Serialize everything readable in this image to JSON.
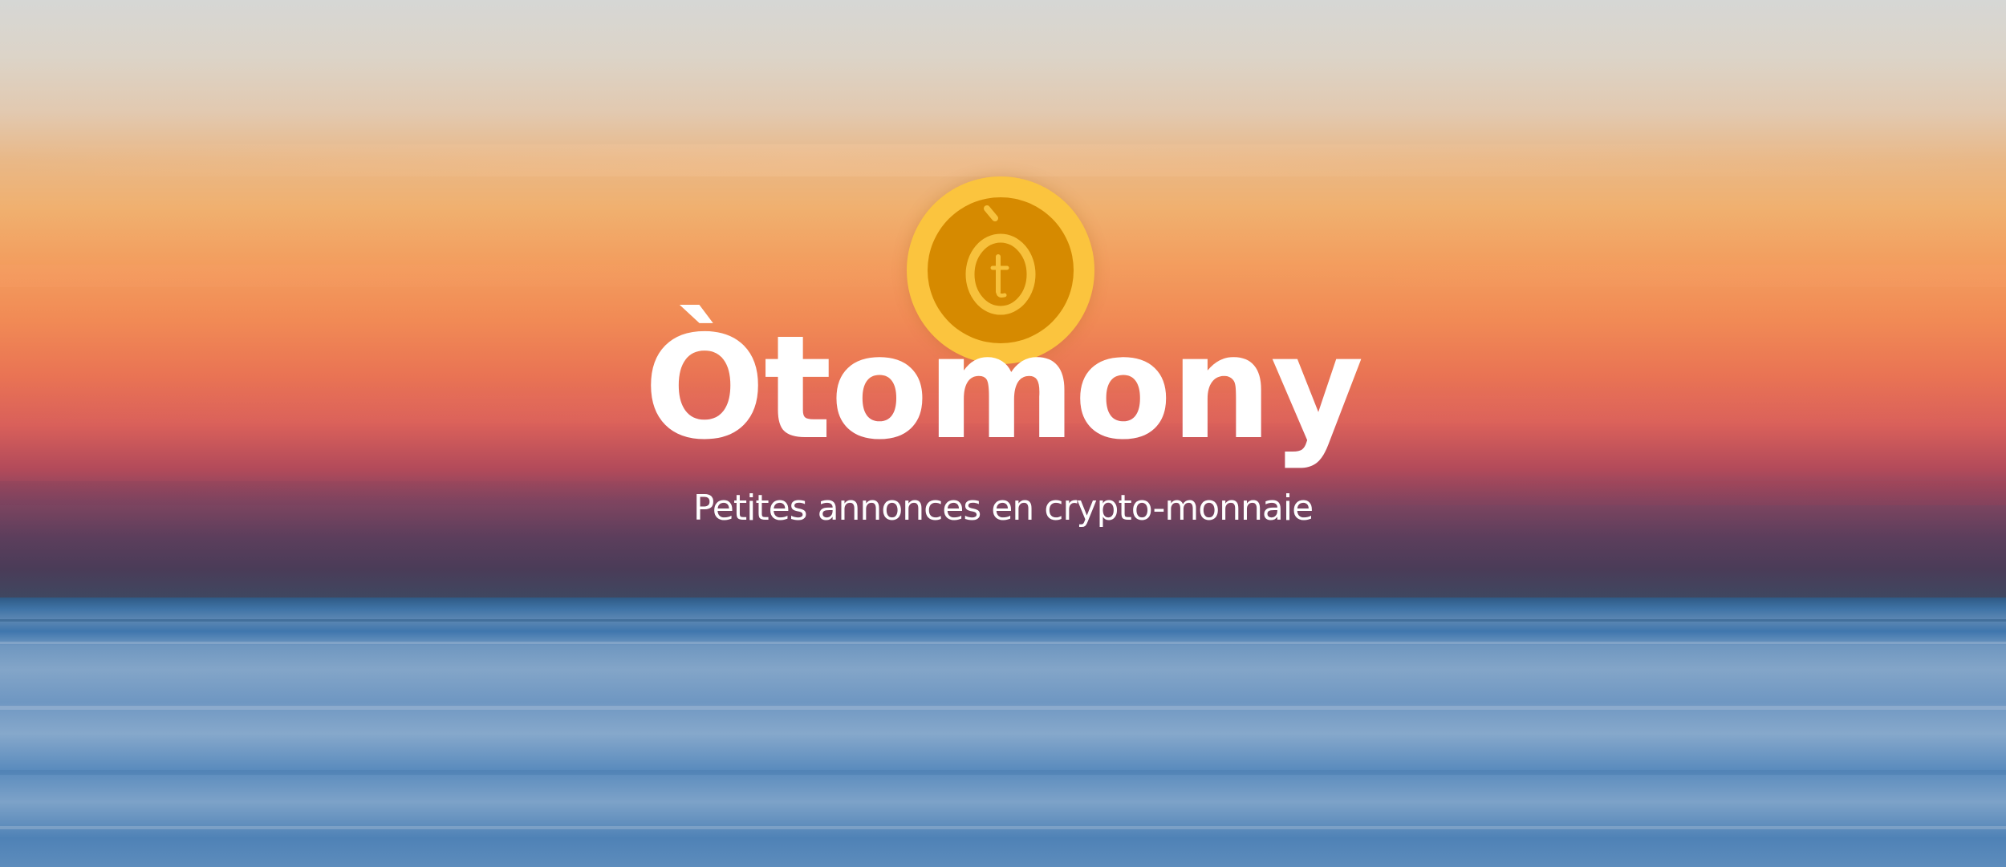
{
  "logo": {
    "brand_name": "Òtomony",
    "coin_glyph": "ò-t coin logo",
    "colors": {
      "coin_outer": "#fbc43e",
      "coin_inner": "#d68a00",
      "glyph": "#f7c13c",
      "text": "#ffffff"
    }
  },
  "tagline": "Petites annonces en crypto-monnaie"
}
